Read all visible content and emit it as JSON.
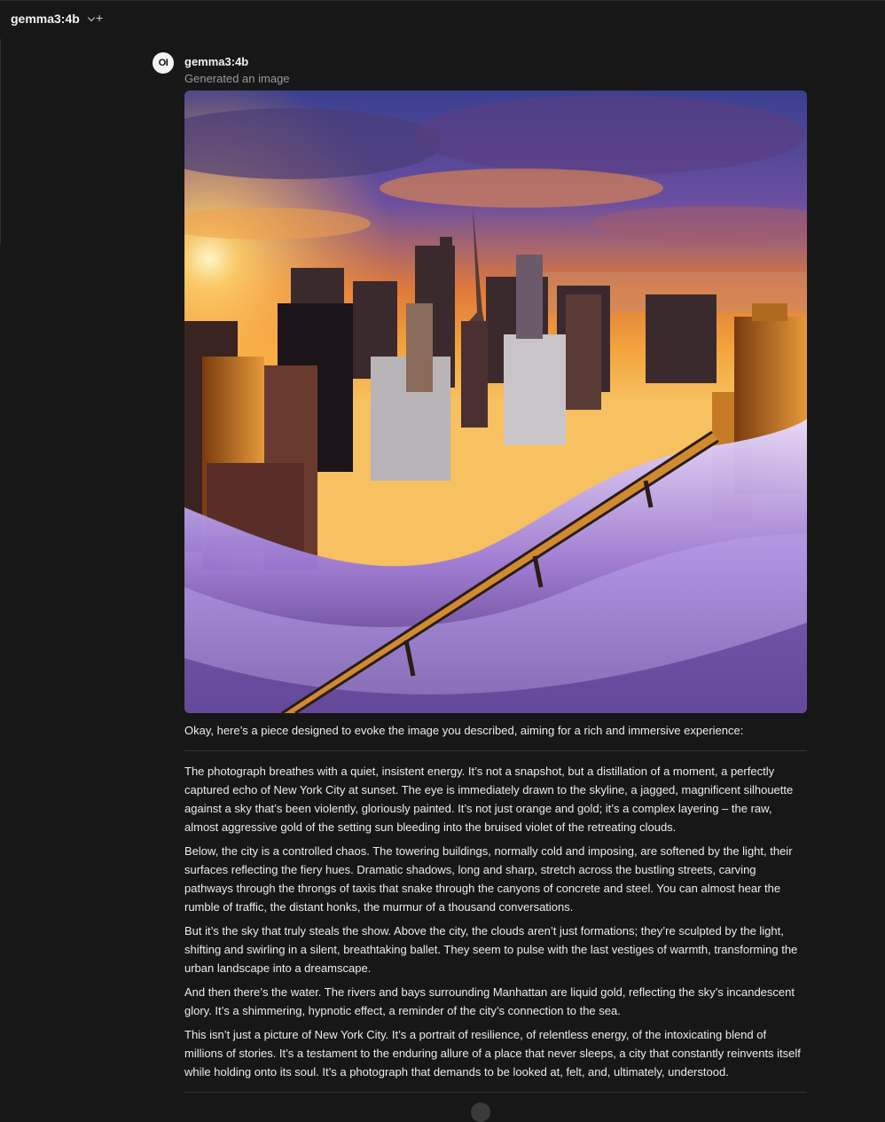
{
  "header": {
    "model_label": "gemma3:4b",
    "new_chat_icon": "plus-icon"
  },
  "message": {
    "avatar_text": "OI",
    "author": "gemma3:4b",
    "status": "Generated an image",
    "intro": "Okay, here’s a piece designed to evoke the image you described, aiming for a rich and immersive experience:",
    "paragraphs": [
      "The photograph breathes with a quiet, insistent energy. It’s not a snapshot, but a distillation of a moment, a perfectly captured echo of New York City at sunset. The eye is immediately drawn to the skyline, a jagged, magnificent silhouette against a sky that’s been violently, gloriously painted. It’s not just orange and gold; it’s a complex layering – the raw, almost aggressive gold of the setting sun bleeding into the bruised violet of the retreating clouds.",
      "Below, the city is a controlled chaos. The towering buildings, normally cold and imposing, are softened by the light, their surfaces reflecting the fiery hues. Dramatic shadows, long and sharp, stretch across the bustling streets, carving pathways through the throngs of taxis that snake through the canyons of concrete and steel. You can almost hear the rumble of traffic, the distant honks, the murmur of a thousand conversations.",
      "But it’s the sky that truly steals the show. Above the city, the clouds aren’t just formations; they’re sculpted by the light, shifting and swirling in a silent, breathtaking ballet. They seem to pulse with the last vestiges of warmth, transforming the urban landscape into a dreamscape.",
      "And then there’s the water. The rivers and bays surrounding Manhattan are liquid gold, reflecting the sky’s incandescent glory. It’s a shimmering, hypnotic effect, a reminder of the city’s connection to the sea.",
      "This isn’t just a picture of New York City. It’s a portrait of resilience, of relentless energy, of the intoxicating blend of millions of stories. It’s a testament to the enduring allure of a place that never sleeps, a city that constantly reinvents itself while holding onto its soul. It’s a photograph that demands to be looked at, felt, and, ultimately, understood."
    ]
  },
  "colors": {
    "background": "#171717",
    "text": "#ececec",
    "muted": "#9a9a9a"
  }
}
